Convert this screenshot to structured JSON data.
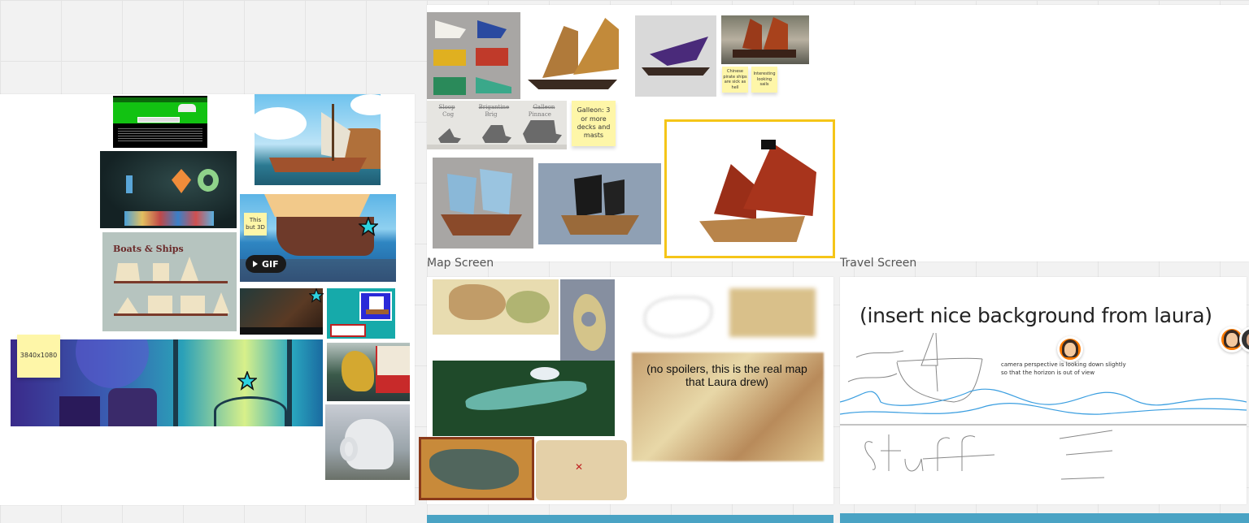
{
  "board": {
    "frames": [
      {
        "id": "ships-frame",
        "label": ""
      },
      {
        "id": "references-frame",
        "label": ""
      },
      {
        "id": "map-frame",
        "label": "Map Screen"
      },
      {
        "id": "travel-frame",
        "label": "Travel Screen"
      }
    ]
  },
  "stickies": {
    "chinese_pirate": "Chinese pirate ships are sick as hell",
    "interesting_sails": "Interesting looking sails",
    "galleon": "Galleon: 3 or more decks and masts",
    "this_but_3d": "This but 3D",
    "resolution": "3840x1080"
  },
  "ship_classes": {
    "row1": [
      "Sloop",
      "Brigantine",
      "Galleon"
    ],
    "row2": [
      "Cog",
      "Brig",
      "Pinnace"
    ]
  },
  "references": {
    "boats_ships_title": "Boats & Ships",
    "gif_label": "GIF"
  },
  "map_screen": {
    "blurred_map_caption": "(no spoilers, this is the real map that Laura drew)"
  },
  "travel_screen": {
    "heading": "(insert nice background from laura)",
    "camera_note_line1": "camera perspective is looking down slightly",
    "camera_note_line2": "so that the horizon is out of view",
    "handwritten": "stuff"
  },
  "colors": {
    "sticky_yellow": "#fef6a8",
    "selection_yellow": "#f5c518",
    "star_cyan": "#2ed3e0",
    "avatar_orange": "#ff7a00",
    "sketch_blue": "#3a9ee0"
  }
}
